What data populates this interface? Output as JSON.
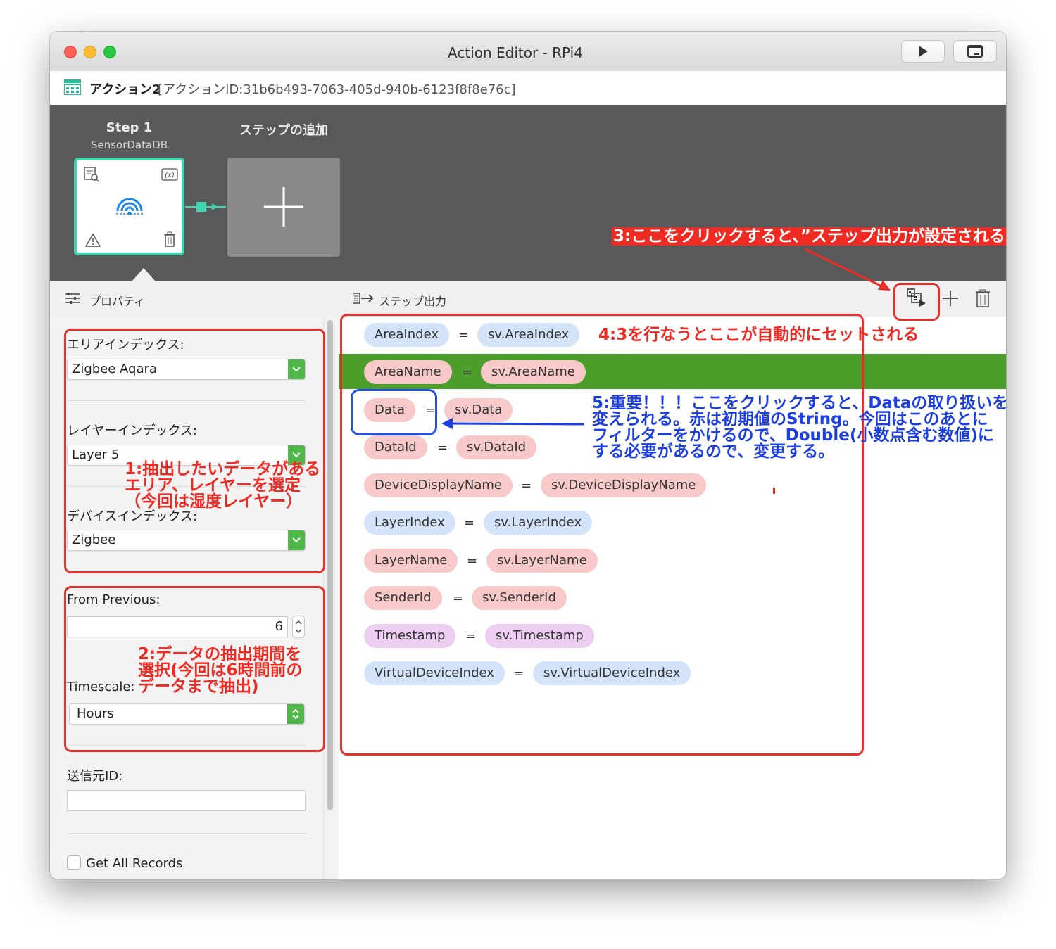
{
  "window": {
    "title": "Action Editor - RPi4",
    "toolbar": {
      "run_icon": "play-icon",
      "console_icon": "terminal-icon"
    }
  },
  "action": {
    "name": "アクション2",
    "id_text": "[アクションID:31b6b493-7063-405d-940b-6123f8f8e76c]"
  },
  "steps": {
    "step1": {
      "title": "Step 1",
      "subtitle": "SensorDataDB"
    },
    "add": {
      "title": "ステップの追加"
    }
  },
  "properties": {
    "header": "プロパティ",
    "area_label": "エリアインデックス:",
    "area_value": "Zigbee Aqara",
    "layer_label": "レイヤーインデックス:",
    "layer_value": "Layer 5",
    "device_label": "デバイスインデックス:",
    "device_value": "Zigbee",
    "from_previous_label": "From Previous:",
    "from_previous_value": "6",
    "timescale_label": "Timescale:",
    "timescale_value": "Hours",
    "sender_label": "送信元ID:",
    "sender_value": "",
    "get_all_label": "Get All Records",
    "get_all_checked": false
  },
  "step_output": {
    "header": "ステップ出力",
    "rows": [
      {
        "key": "AreaIndex",
        "eq": "=",
        "value": "sv.AreaIndex",
        "color": "blue"
      },
      {
        "key": "AreaName",
        "eq": "=",
        "value": "sv.AreaName",
        "color": "red",
        "selected": true
      },
      {
        "key": "Data",
        "eq": "=",
        "value": "sv.Data",
        "color": "red"
      },
      {
        "key": "DataId",
        "eq": "=",
        "value": "sv.DataId",
        "color": "red"
      },
      {
        "key": "DeviceDisplayName",
        "eq": "=",
        "value": "sv.DeviceDisplayName",
        "color": "red"
      },
      {
        "key": "LayerIndex",
        "eq": "=",
        "value": "sv.LayerIndex",
        "color": "blue"
      },
      {
        "key": "LayerName",
        "eq": "=",
        "value": "sv.LayerName",
        "color": "red"
      },
      {
        "key": "SenderId",
        "eq": "=",
        "value": "sv.SenderId",
        "color": "red"
      },
      {
        "key": "Timestamp",
        "eq": "=",
        "value": "sv.Timestamp",
        "color": "purple"
      },
      {
        "key": "VirtualDeviceIndex",
        "eq": "=",
        "value": "sv.VirtualDeviceIndex",
        "color": "blue"
      }
    ]
  },
  "annotations": {
    "note1": [
      "1:抽出したいデータがある",
      "エリア、レイヤーを選定",
      "（今回は湿度レイヤー）"
    ],
    "note2": [
      "2:データの抽出期間を",
      "選択(今回は6時間前の",
      "データまで抽出)"
    ],
    "note3": "3:ここをクリックすると、”ステップ出力が設定される",
    "note4": "4:3を行なうとここが自動的にセットされる",
    "note5": [
      "5:重要！！！ここをクリックすると、Dataの取り扱いを",
      "変えられる。赤は初期値のString。今回はこのあとに",
      "フィルターをかけるので、Double(小数点含む数値)に",
      "する必要があるので、変更する。"
    ]
  },
  "colors": {
    "pill_blue": "#d3e3fa",
    "pill_red": "#f7c9c9",
    "pill_purple": "#edcdf2",
    "selected_row": "#4c9e2b",
    "step_border": "#3ed6b0",
    "annotation_red": "#ef2a23",
    "annotation_blue": "#1d3ee0"
  }
}
